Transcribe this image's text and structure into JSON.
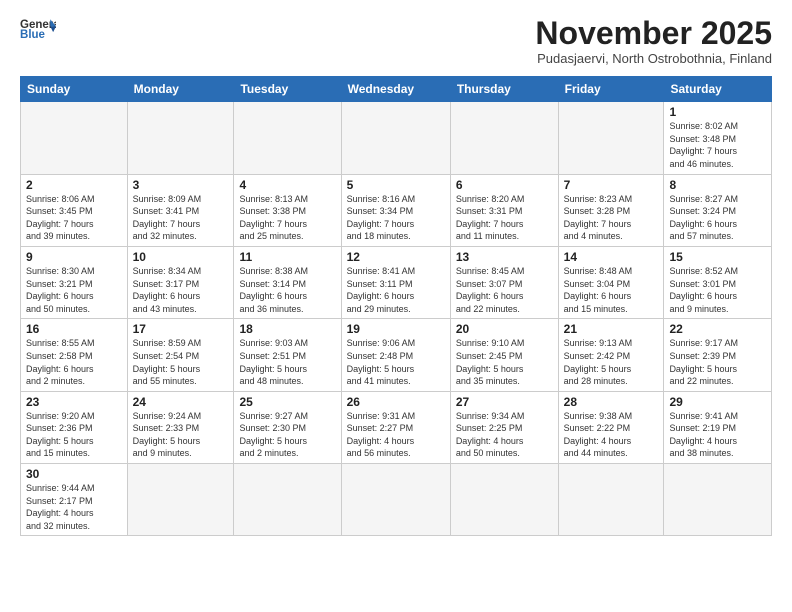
{
  "header": {
    "logo_general": "General",
    "logo_blue": "Blue",
    "month_title": "November 2025",
    "subtitle": "Pudasjaervi, North Ostrobothnia, Finland"
  },
  "days_of_week": [
    "Sunday",
    "Monday",
    "Tuesday",
    "Wednesday",
    "Thursday",
    "Friday",
    "Saturday"
  ],
  "weeks": [
    [
      {
        "num": "",
        "info": ""
      },
      {
        "num": "",
        "info": ""
      },
      {
        "num": "",
        "info": ""
      },
      {
        "num": "",
        "info": ""
      },
      {
        "num": "",
        "info": ""
      },
      {
        "num": "",
        "info": ""
      },
      {
        "num": "1",
        "info": "Sunrise: 8:02 AM\nSunset: 3:48 PM\nDaylight: 7 hours\nand 46 minutes."
      }
    ],
    [
      {
        "num": "2",
        "info": "Sunrise: 8:06 AM\nSunset: 3:45 PM\nDaylight: 7 hours\nand 39 minutes."
      },
      {
        "num": "3",
        "info": "Sunrise: 8:09 AM\nSunset: 3:41 PM\nDaylight: 7 hours\nand 32 minutes."
      },
      {
        "num": "4",
        "info": "Sunrise: 8:13 AM\nSunset: 3:38 PM\nDaylight: 7 hours\nand 25 minutes."
      },
      {
        "num": "5",
        "info": "Sunrise: 8:16 AM\nSunset: 3:34 PM\nDaylight: 7 hours\nand 18 minutes."
      },
      {
        "num": "6",
        "info": "Sunrise: 8:20 AM\nSunset: 3:31 PM\nDaylight: 7 hours\nand 11 minutes."
      },
      {
        "num": "7",
        "info": "Sunrise: 8:23 AM\nSunset: 3:28 PM\nDaylight: 7 hours\nand 4 minutes."
      },
      {
        "num": "8",
        "info": "Sunrise: 8:27 AM\nSunset: 3:24 PM\nDaylight: 6 hours\nand 57 minutes."
      }
    ],
    [
      {
        "num": "9",
        "info": "Sunrise: 8:30 AM\nSunset: 3:21 PM\nDaylight: 6 hours\nand 50 minutes."
      },
      {
        "num": "10",
        "info": "Sunrise: 8:34 AM\nSunset: 3:17 PM\nDaylight: 6 hours\nand 43 minutes."
      },
      {
        "num": "11",
        "info": "Sunrise: 8:38 AM\nSunset: 3:14 PM\nDaylight: 6 hours\nand 36 minutes."
      },
      {
        "num": "12",
        "info": "Sunrise: 8:41 AM\nSunset: 3:11 PM\nDaylight: 6 hours\nand 29 minutes."
      },
      {
        "num": "13",
        "info": "Sunrise: 8:45 AM\nSunset: 3:07 PM\nDaylight: 6 hours\nand 22 minutes."
      },
      {
        "num": "14",
        "info": "Sunrise: 8:48 AM\nSunset: 3:04 PM\nDaylight: 6 hours\nand 15 minutes."
      },
      {
        "num": "15",
        "info": "Sunrise: 8:52 AM\nSunset: 3:01 PM\nDaylight: 6 hours\nand 9 minutes."
      }
    ],
    [
      {
        "num": "16",
        "info": "Sunrise: 8:55 AM\nSunset: 2:58 PM\nDaylight: 6 hours\nand 2 minutes."
      },
      {
        "num": "17",
        "info": "Sunrise: 8:59 AM\nSunset: 2:54 PM\nDaylight: 5 hours\nand 55 minutes."
      },
      {
        "num": "18",
        "info": "Sunrise: 9:03 AM\nSunset: 2:51 PM\nDaylight: 5 hours\nand 48 minutes."
      },
      {
        "num": "19",
        "info": "Sunrise: 9:06 AM\nSunset: 2:48 PM\nDaylight: 5 hours\nand 41 minutes."
      },
      {
        "num": "20",
        "info": "Sunrise: 9:10 AM\nSunset: 2:45 PM\nDaylight: 5 hours\nand 35 minutes."
      },
      {
        "num": "21",
        "info": "Sunrise: 9:13 AM\nSunset: 2:42 PM\nDaylight: 5 hours\nand 28 minutes."
      },
      {
        "num": "22",
        "info": "Sunrise: 9:17 AM\nSunset: 2:39 PM\nDaylight: 5 hours\nand 22 minutes."
      }
    ],
    [
      {
        "num": "23",
        "info": "Sunrise: 9:20 AM\nSunset: 2:36 PM\nDaylight: 5 hours\nand 15 minutes."
      },
      {
        "num": "24",
        "info": "Sunrise: 9:24 AM\nSunset: 2:33 PM\nDaylight: 5 hours\nand 9 minutes."
      },
      {
        "num": "25",
        "info": "Sunrise: 9:27 AM\nSunset: 2:30 PM\nDaylight: 5 hours\nand 2 minutes."
      },
      {
        "num": "26",
        "info": "Sunrise: 9:31 AM\nSunset: 2:27 PM\nDaylight: 4 hours\nand 56 minutes."
      },
      {
        "num": "27",
        "info": "Sunrise: 9:34 AM\nSunset: 2:25 PM\nDaylight: 4 hours\nand 50 minutes."
      },
      {
        "num": "28",
        "info": "Sunrise: 9:38 AM\nSunset: 2:22 PM\nDaylight: 4 hours\nand 44 minutes."
      },
      {
        "num": "29",
        "info": "Sunrise: 9:41 AM\nSunset: 2:19 PM\nDaylight: 4 hours\nand 38 minutes."
      }
    ],
    [
      {
        "num": "30",
        "info": "Sunrise: 9:44 AM\nSunset: 2:17 PM\nDaylight: 4 hours\nand 32 minutes."
      },
      {
        "num": "",
        "info": ""
      },
      {
        "num": "",
        "info": ""
      },
      {
        "num": "",
        "info": ""
      },
      {
        "num": "",
        "info": ""
      },
      {
        "num": "",
        "info": ""
      },
      {
        "num": "",
        "info": ""
      }
    ]
  ]
}
